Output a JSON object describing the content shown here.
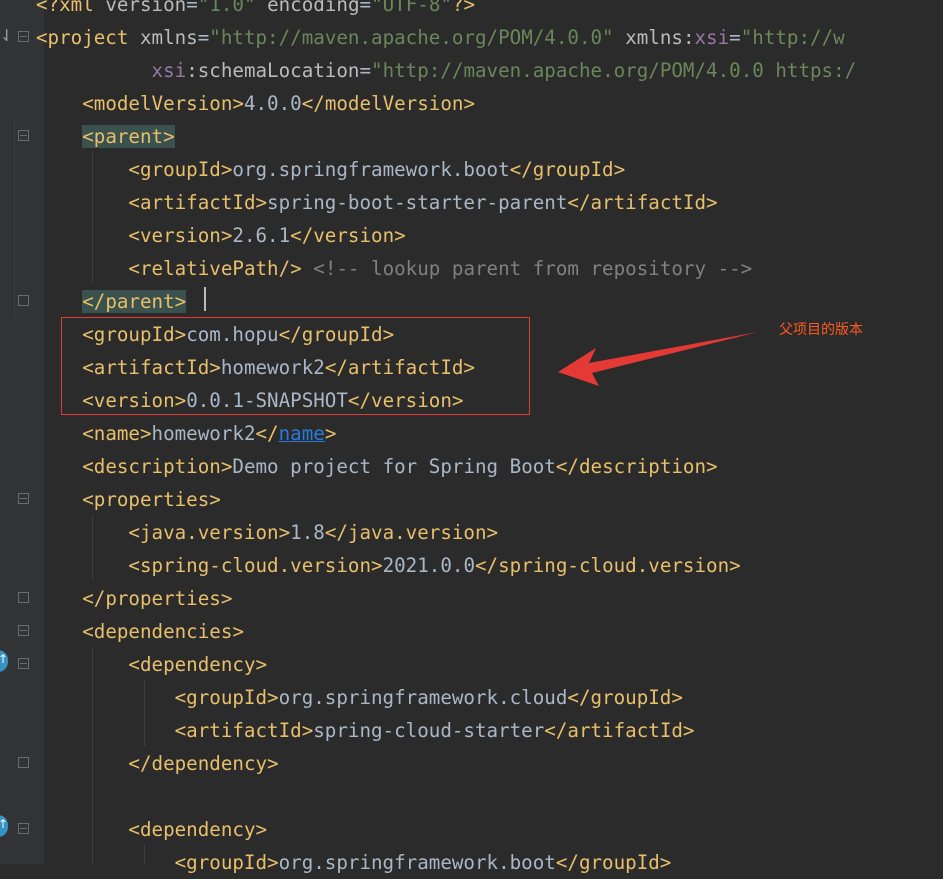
{
  "editor": {
    "lines": [
      {
        "indent": "",
        "parts": [
          {
            "c": "tag",
            "t": "<?xml "
          },
          {
            "c": "attr",
            "t": "version"
          },
          {
            "c": "txt",
            "t": "="
          },
          {
            "c": "val",
            "t": "\"1.0\""
          },
          {
            "c": "txt",
            "t": " "
          },
          {
            "c": "attr",
            "t": "encoding"
          },
          {
            "c": "txt",
            "t": "="
          },
          {
            "c": "val",
            "t": "\"UTF-8\""
          },
          {
            "c": "tag",
            "t": "?>"
          }
        ]
      },
      {
        "indent": "",
        "parts": [
          {
            "c": "tag",
            "t": "<project "
          },
          {
            "c": "attr",
            "t": "xmlns"
          },
          {
            "c": "txt",
            "t": "="
          },
          {
            "c": "val",
            "t": "\"http://maven.apache.org/POM/4.0.0\""
          },
          {
            "c": "txt",
            "t": " "
          },
          {
            "c": "attr",
            "t": "xmlns:"
          },
          {
            "c": "ns",
            "t": "xsi"
          },
          {
            "c": "txt",
            "t": "="
          },
          {
            "c": "val",
            "t": "\"http://w"
          }
        ]
      },
      {
        "indent": "          ",
        "parts": [
          {
            "c": "ns",
            "t": "xsi"
          },
          {
            "c": "attr",
            "t": ":schemaLocation"
          },
          {
            "c": "txt",
            "t": "="
          },
          {
            "c": "val",
            "t": "\"http://maven.apache.org/POM/4.0.0 https:/"
          }
        ]
      },
      {
        "indent": "    ",
        "parts": [
          {
            "c": "tag",
            "t": "<modelVersion>"
          },
          {
            "c": "txt",
            "t": "4.0.0"
          },
          {
            "c": "tag",
            "t": "</modelVersion>"
          }
        ]
      },
      {
        "indent": "    ",
        "parts": [
          {
            "c": "tag hl",
            "t": "<parent>"
          }
        ]
      },
      {
        "indent": "        ",
        "parts": [
          {
            "c": "tag",
            "t": "<groupId>"
          },
          {
            "c": "txt",
            "t": "org.springframework.boot"
          },
          {
            "c": "tag",
            "t": "</groupId>"
          }
        ]
      },
      {
        "indent": "        ",
        "parts": [
          {
            "c": "tag",
            "t": "<artifactId>"
          },
          {
            "c": "txt",
            "t": "spring-boot-starter-parent"
          },
          {
            "c": "tag",
            "t": "</artifactId>"
          }
        ]
      },
      {
        "indent": "        ",
        "parts": [
          {
            "c": "tag",
            "t": "<version>"
          },
          {
            "c": "txt",
            "t": "2.6.1"
          },
          {
            "c": "tag",
            "t": "</version>"
          }
        ]
      },
      {
        "indent": "        ",
        "parts": [
          {
            "c": "tag",
            "t": "<relativePath/>"
          },
          {
            "c": "txt",
            "t": " "
          },
          {
            "c": "cmt",
            "t": "<!-- lookup parent from repository -->"
          }
        ]
      },
      {
        "indent": "    ",
        "parts": [
          {
            "c": "tag hl",
            "t": "</parent>"
          }
        ]
      },
      {
        "indent": "    ",
        "parts": [
          {
            "c": "tag",
            "t": "<groupId>"
          },
          {
            "c": "txt",
            "t": "com.hopu"
          },
          {
            "c": "tag",
            "t": "</groupId>"
          }
        ]
      },
      {
        "indent": "    ",
        "parts": [
          {
            "c": "tag",
            "t": "<artifactId>"
          },
          {
            "c": "txt",
            "t": "homework2"
          },
          {
            "c": "tag",
            "t": "</artifactId>"
          }
        ]
      },
      {
        "indent": "    ",
        "parts": [
          {
            "c": "tag",
            "t": "<version>"
          },
          {
            "c": "txt",
            "t": "0.0.1-SNAPSHOT"
          },
          {
            "c": "tag",
            "t": "</version>"
          }
        ]
      },
      {
        "indent": "    ",
        "parts": [
          {
            "c": "tag",
            "t": "<name>"
          },
          {
            "c": "txt",
            "t": "homework2"
          },
          {
            "c": "tag",
            "t": "</"
          },
          {
            "c": "link",
            "t": "name"
          },
          {
            "c": "tag",
            "t": ">"
          }
        ]
      },
      {
        "indent": "    ",
        "parts": [
          {
            "c": "tag",
            "t": "<description>"
          },
          {
            "c": "txt",
            "t": "Demo project for Spring Boot"
          },
          {
            "c": "tag",
            "t": "</description>"
          }
        ]
      },
      {
        "indent": "    ",
        "parts": [
          {
            "c": "tag",
            "t": "<properties>"
          }
        ]
      },
      {
        "indent": "        ",
        "parts": [
          {
            "c": "tag",
            "t": "<java.version>"
          },
          {
            "c": "txt",
            "t": "1.8"
          },
          {
            "c": "tag",
            "t": "</java.version>"
          }
        ]
      },
      {
        "indent": "        ",
        "parts": [
          {
            "c": "tag",
            "t": "<spring-cloud.version>"
          },
          {
            "c": "txt",
            "t": "2021.0.0"
          },
          {
            "c": "tag",
            "t": "</spring-cloud.version>"
          }
        ]
      },
      {
        "indent": "    ",
        "parts": [
          {
            "c": "tag",
            "t": "</properties>"
          }
        ]
      },
      {
        "indent": "    ",
        "parts": [
          {
            "c": "tag",
            "t": "<dependencies>"
          }
        ]
      },
      {
        "indent": "        ",
        "parts": [
          {
            "c": "tag",
            "t": "<dependency>"
          }
        ]
      },
      {
        "indent": "            ",
        "parts": [
          {
            "c": "tag",
            "t": "<groupId>"
          },
          {
            "c": "txt",
            "t": "org.springframework.cloud"
          },
          {
            "c": "tag",
            "t": "</groupId>"
          }
        ]
      },
      {
        "indent": "            ",
        "parts": [
          {
            "c": "tag",
            "t": "<artifactId>"
          },
          {
            "c": "txt",
            "t": "spring-cloud-starter"
          },
          {
            "c": "tag",
            "t": "</artifactId>"
          }
        ]
      },
      {
        "indent": "        ",
        "parts": [
          {
            "c": "tag",
            "t": "</dependency>"
          }
        ]
      },
      {
        "indent": "",
        "parts": []
      },
      {
        "indent": "        ",
        "parts": [
          {
            "c": "tag",
            "t": "<dependency>"
          }
        ]
      },
      {
        "indent": "            ",
        "parts": [
          {
            "c": "tag",
            "t": "<groupId>"
          },
          {
            "c": "txt",
            "t": "org.springframework.boot"
          },
          {
            "c": "tag",
            "t": "</groupId>"
          }
        ]
      }
    ]
  },
  "annotation": {
    "text": "父项目的版本"
  },
  "colors": {
    "tag": "#e8bf6a",
    "text": "#a9b7c6",
    "value": "#6a8759",
    "comment": "#808080",
    "annotation": "#ff5a1f",
    "box": "#e53935"
  }
}
